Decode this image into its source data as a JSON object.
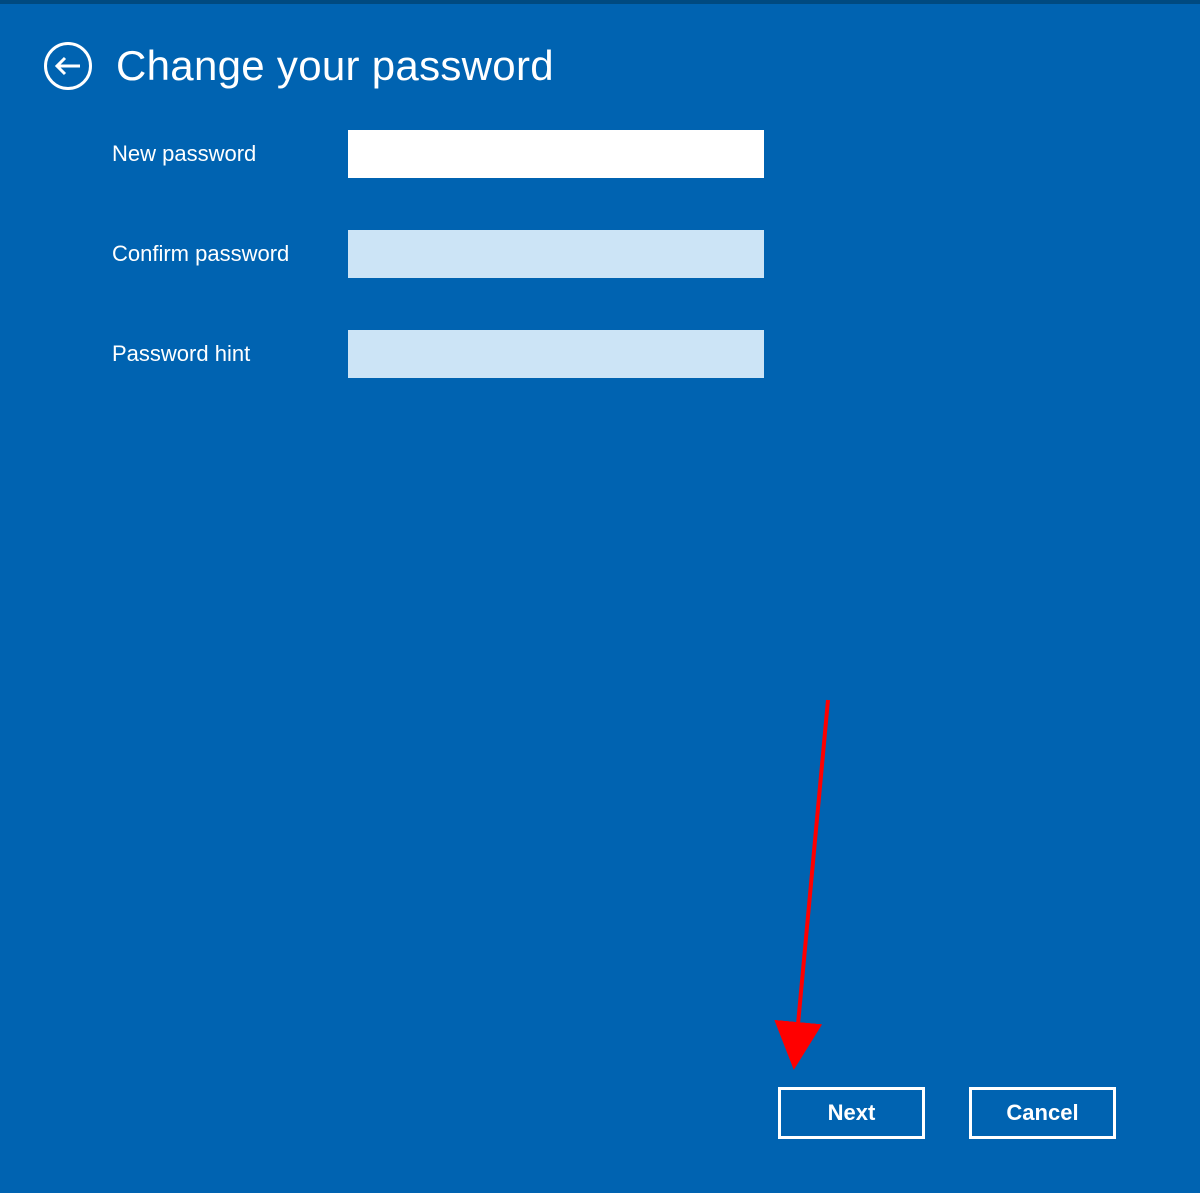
{
  "header": {
    "title": "Change your password"
  },
  "form": {
    "new_password": {
      "label": "New password",
      "value": ""
    },
    "confirm_password": {
      "label": "Confirm password",
      "value": ""
    },
    "password_hint": {
      "label": "Password hint",
      "value": ""
    }
  },
  "footer": {
    "next_label": "Next",
    "cancel_label": "Cancel"
  }
}
